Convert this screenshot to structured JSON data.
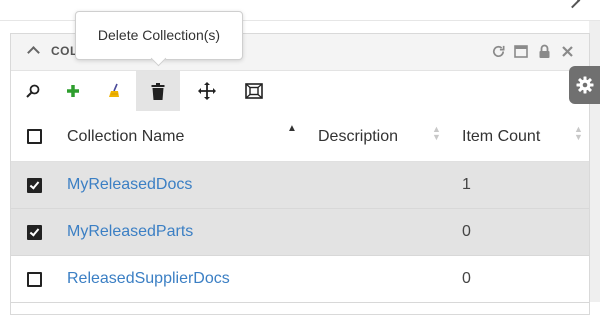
{
  "panel": {
    "title": "COLLECTIONS",
    "tooltip": "Delete Collection(s)"
  },
  "header_icons": [
    "refresh-icon",
    "maximize-icon",
    "lock-icon",
    "close-icon"
  ],
  "toolbar": {
    "buttons": [
      "search-icon",
      "add-icon",
      "clear-icon",
      "delete-icon",
      "move-icon",
      "fit-icon"
    ]
  },
  "grid": {
    "columns": [
      "Collection Name",
      "Description",
      "Item Count"
    ],
    "sorted_column": "Collection Name",
    "rows": [
      {
        "name": "MyReleasedDocs",
        "description": "",
        "count": "1",
        "checked": true
      },
      {
        "name": "MyReleasedParts",
        "description": "",
        "count": "0",
        "checked": true
      },
      {
        "name": "ReleasedSupplierDocs",
        "description": "",
        "count": "0",
        "checked": false
      }
    ]
  },
  "colors": {
    "link": "#3b7fc4",
    "selected_row": "#e3e3e3",
    "add": "#2e9e2e",
    "gear_tab": "#707070"
  }
}
